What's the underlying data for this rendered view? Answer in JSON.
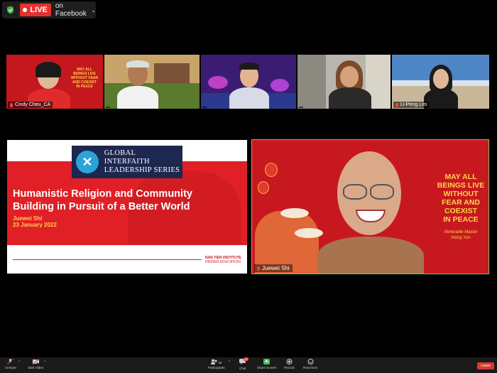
{
  "live": {
    "badge": "LIVE",
    "destination": "on Facebook",
    "chevron": "⌄",
    "shield_color": "#3bb54a",
    "badge_color": "#e5312f"
  },
  "gallery": [
    {
      "name": "Cindy Cheu_CA",
      "muted": true,
      "bg": "#b8161d",
      "quote": "MAY ALL BEINGS LIVE WITHOUT FEAR AND COEXIST IN PEACE"
    },
    {
      "name": "",
      "muted": false,
      "bg": "#6f8a3e"
    },
    {
      "name": "",
      "muted": false,
      "bg": "#3a1d72"
    },
    {
      "name": "",
      "muted": false,
      "bg": "#b9b6ad"
    },
    {
      "name": "Li-Peng Lim",
      "muted": true,
      "bg": "#3a6fb0"
    }
  ],
  "slide": {
    "series": [
      "GLOBAL INTERFAITH",
      "LEADERSHIP SERIES"
    ],
    "title": "Humanistic Religion and Community Building in Pursuit of a Better World",
    "author": "Juewei Shi",
    "date": "23 January 2022",
    "footer": [
      "NAN TIEN INSTITUTE",
      "HIGHER EDUCATION"
    ]
  },
  "speaker": {
    "name": "Juewei Shi",
    "quote": [
      "MAY ALL",
      "BEINGS LIVE",
      "WITHOUT",
      "FEAR AND",
      "COEXIST",
      "IN PEACE"
    ],
    "quote_by": [
      "Venerable Master",
      "Hsing Yun"
    ]
  },
  "toolbar": {
    "unmute": "Unmute",
    "start_video": "Start Video",
    "participants": "Participants",
    "participants_count": "46",
    "chat": "Chat",
    "chat_badge": "18",
    "share_screen": "Share Screen",
    "record": "Record",
    "reactions": "Reactions",
    "leave": "Leave"
  }
}
